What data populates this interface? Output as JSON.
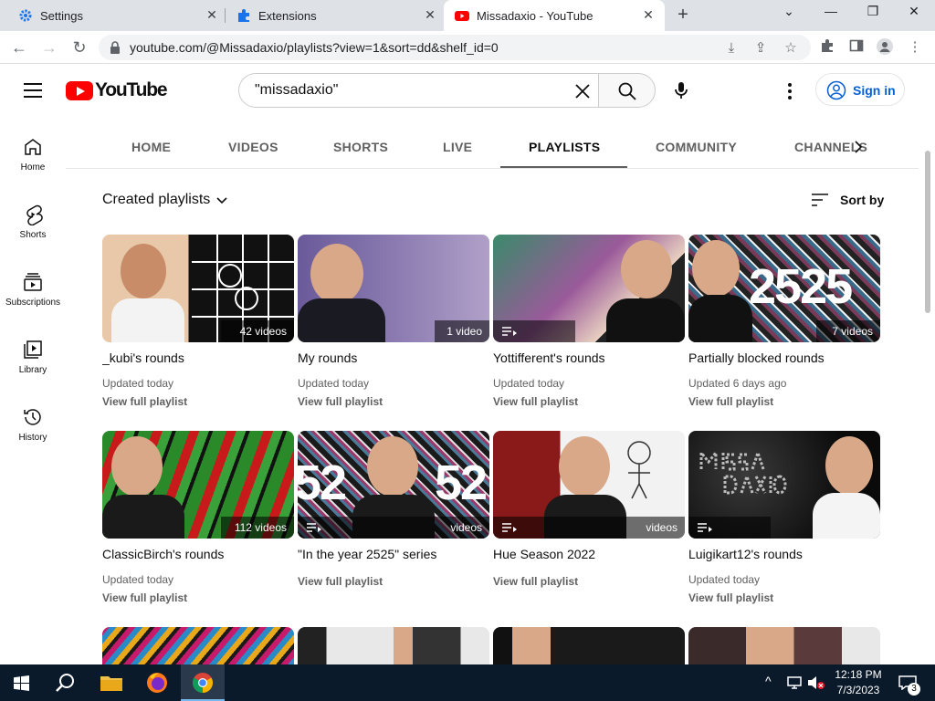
{
  "browser": {
    "tabs": [
      {
        "title": "Settings",
        "icon": "gear-icon"
      },
      {
        "title": "Extensions",
        "icon": "puzzle-icon"
      },
      {
        "title": "Missadaxio - YouTube",
        "icon": "youtube-icon",
        "active": true
      }
    ],
    "url": "youtube.com/@Missadaxio/playlists?view=1&sort=dd&shelf_id=0"
  },
  "yt": {
    "logo_text": "YouTube",
    "search_query": "\"missadaxio\"",
    "signin_label": "Sign in",
    "guide": [
      {
        "label": "Home",
        "icon": "home-icon"
      },
      {
        "label": "Shorts",
        "icon": "shorts-icon"
      },
      {
        "label": "Subscriptions",
        "icon": "subscriptions-icon"
      },
      {
        "label": "Library",
        "icon": "library-icon"
      },
      {
        "label": "History",
        "icon": "history-icon"
      }
    ],
    "channel_tabs": [
      "HOME",
      "VIDEOS",
      "SHORTS",
      "LIVE",
      "PLAYLISTS",
      "COMMUNITY",
      "CHANNELS"
    ],
    "active_tab": "PLAYLISTS",
    "section_title": "Created playlists",
    "sort_label": "Sort by",
    "playlists": [
      {
        "title": "_kubi's rounds",
        "count": "42 videos",
        "updated": "Updated today",
        "view": "View full playlist"
      },
      {
        "title": "My rounds",
        "count": "1 video",
        "updated": "Updated today",
        "view": "View full playlist"
      },
      {
        "title": "Yottifferent's rounds",
        "count": "",
        "updated": "Updated today",
        "view": "View full playlist"
      },
      {
        "title": "Partially blocked rounds",
        "count": "7 videos",
        "updated": "Updated 6 days ago",
        "view": "View full playlist"
      },
      {
        "title": "ClassicBirch's rounds",
        "count": "112 videos",
        "updated": "Updated today",
        "view": "View full playlist"
      },
      {
        "title": "\"In the year 2525\" series",
        "count": "videos",
        "updated": "",
        "view": "View full playlist"
      },
      {
        "title": "Hue Season 2022",
        "count": "videos",
        "updated": "",
        "view": "View full playlist"
      },
      {
        "title": "Luigikart12's rounds",
        "count": "",
        "updated": "Updated today",
        "view": "View full playlist"
      }
    ]
  },
  "taskbar": {
    "time": "12:18 PM",
    "date": "7/3/2023",
    "notification_count": "3"
  },
  "colors": {
    "yt_red": "#ff0000",
    "link_blue": "#065fd4",
    "taskbar": "#0b1a2a"
  }
}
